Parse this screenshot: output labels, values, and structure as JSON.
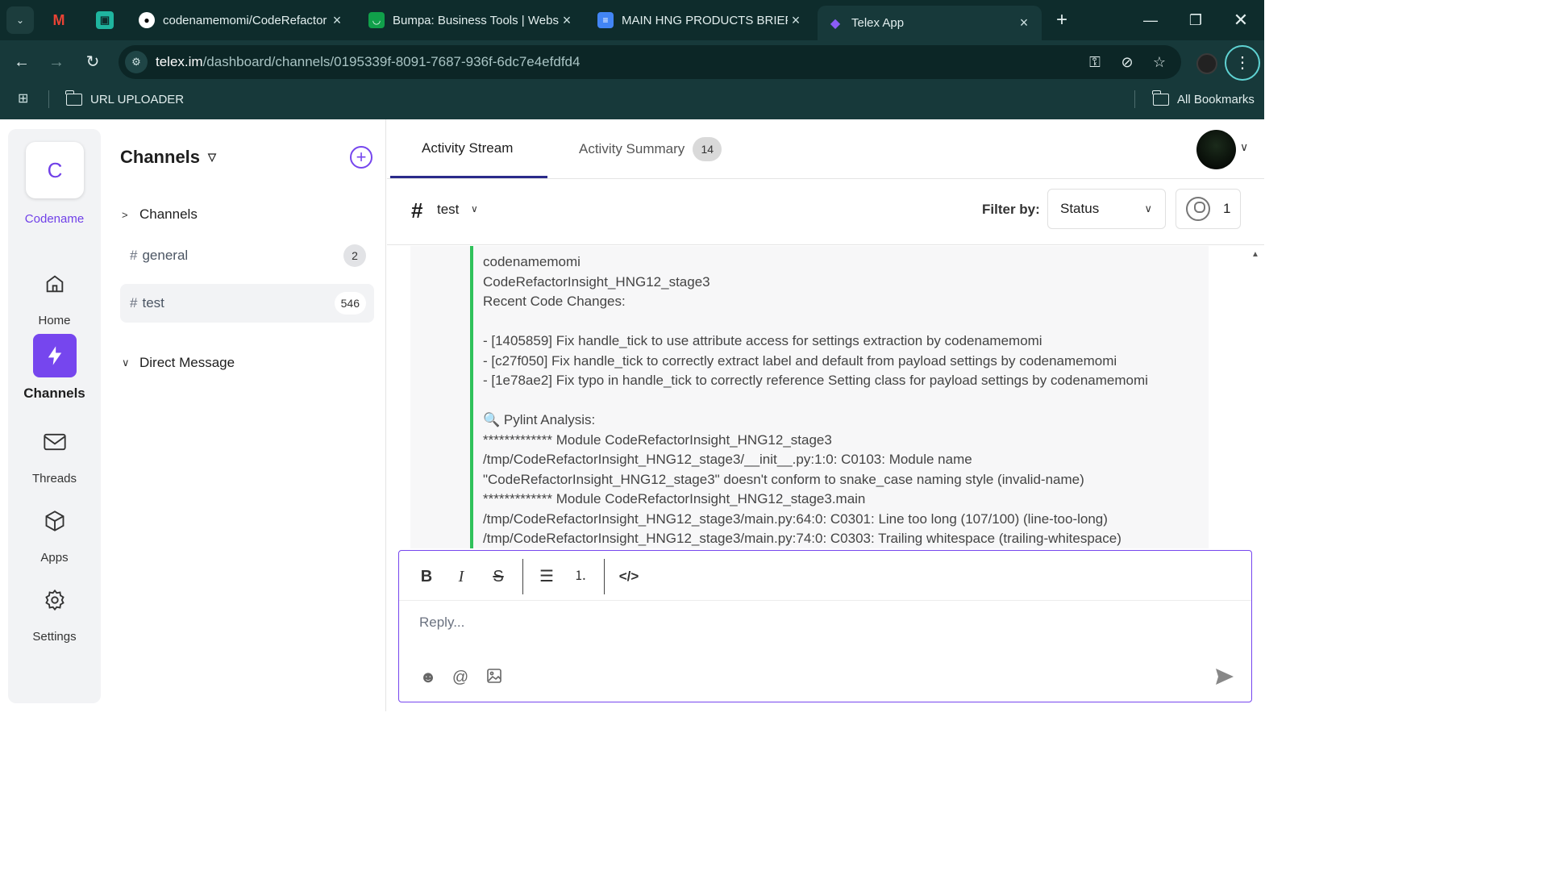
{
  "browser": {
    "tabs": [
      {
        "title": "codenamemomi/CodeRefactor",
        "icon": "github-icon"
      },
      {
        "title": "Bumpa: Business Tools | Websi",
        "icon": "bumpa-icon"
      },
      {
        "title": "MAIN HNG PRODUCTS BRIEF",
        "icon": "docs-icon"
      },
      {
        "title": "Telex App",
        "icon": "telex-icon"
      }
    ],
    "url_domain": "telex.im",
    "url_path": "/dashboard/channels/0195339f-8091-7687-936f-6dc7e4efdfd4",
    "bookmarks": {
      "folder": "URL UPLOADER",
      "all": "All Bookmarks"
    }
  },
  "rail": {
    "workspace_initial": "C",
    "workspace_name": "Codename",
    "items": [
      {
        "label": "Home",
        "icon": "home-icon"
      },
      {
        "label": "Channels",
        "icon": "lightning-icon"
      },
      {
        "label": "Threads",
        "icon": "mail-icon"
      },
      {
        "label": "Apps",
        "icon": "cube-icon"
      },
      {
        "label": "Settings",
        "icon": "gear-icon"
      }
    ]
  },
  "channels_panel": {
    "title": "Channels",
    "section_channels": "Channels",
    "channels": [
      {
        "hash": "#",
        "name": "general",
        "count": "2"
      },
      {
        "hash": "#",
        "name": "test",
        "count": "546"
      }
    ],
    "section_dm": "Direct Message"
  },
  "main": {
    "tabs": [
      {
        "label": "Activity Stream"
      },
      {
        "label": "Activity Summary",
        "badge": "14"
      }
    ],
    "channel_hash": "#",
    "channel_name": "test",
    "filter_label": "Filter by:",
    "filter_value": "Status",
    "members_count": "1"
  },
  "message": {
    "lines": [
      "codenamemomi",
      "CodeRefactorInsight_HNG12_stage3",
      "Recent Code Changes:",
      "",
      "- [1405859] Fix handle_tick to use attribute access for settings extraction by codenamemomi",
      "- [c27f050] Fix handle_tick to correctly extract label and default from payload settings by codenamemomi",
      "- [1e78ae2] Fix typo in handle_tick to correctly reference Setting class for payload settings by codenamemomi",
      "",
      "🔍 Pylint Analysis:",
      "************* Module CodeRefactorInsight_HNG12_stage3",
      "/tmp/CodeRefactorInsight_HNG12_stage3/__init__.py:1:0: C0103: Module name",
      "\"CodeRefactorInsight_HNG12_stage3\" doesn't conform to snake_case naming style (invalid-name)",
      "************* Module CodeRefactorInsight_HNG12_stage3.main",
      "/tmp/CodeRefactorInsight_HNG12_stage3/main.py:64:0: C0301: Line too long (107/100) (line-too-long)",
      "/tmp/CodeRefactorInsight_HNG12_stage3/main.py:74:0: C0303: Trailing whitespace (trailing-whitespace)"
    ]
  },
  "composer": {
    "placeholder": "Reply..."
  },
  "colors": {
    "accent": "#7646ee",
    "message_border": "#2fc15a",
    "chrome_bg": "#0e2c2c"
  }
}
